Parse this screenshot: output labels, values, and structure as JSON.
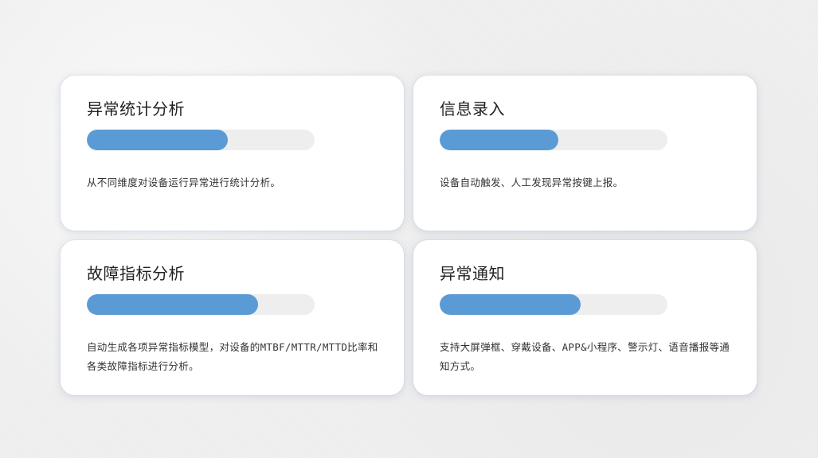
{
  "cards": [
    {
      "title": "异常统计分析",
      "progress": 0.62,
      "description": "从不同维度对设备运行异常进行统计分析。"
    },
    {
      "title": "信息录入",
      "progress": 0.52,
      "description": "设备自动触发、人工发现异常按键上报。"
    },
    {
      "title": "故障指标分析",
      "progress": 0.75,
      "description": "自动生成各项异常指标模型，对设备的MTBF/MTTR/MTTD比率和各类故障指标进行分析。"
    },
    {
      "title": "异常通知",
      "progress": 0.62,
      "description": "支持大屏弹框、穿戴设备、APP&小程序、警示灯、语音播报等通知方式。"
    }
  ],
  "colors": {
    "progress_fill": "#5b9bd5",
    "progress_track": "#eeeeee",
    "card_background": "#ffffff"
  }
}
